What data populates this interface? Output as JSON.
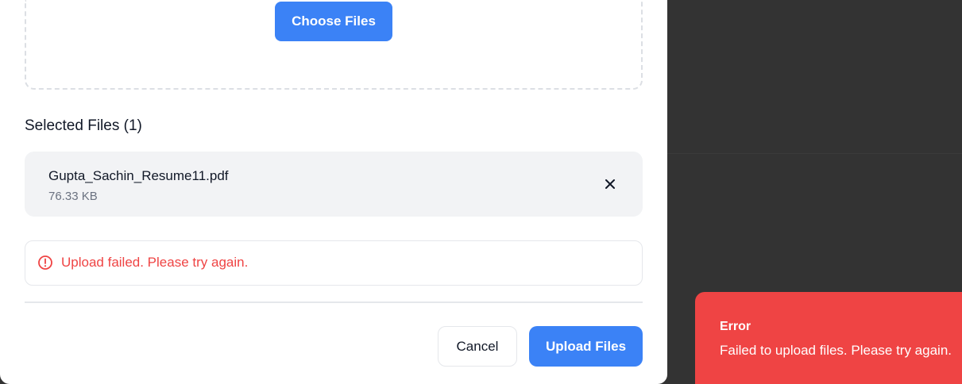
{
  "upload_dialog": {
    "choose_files_label": "Choose Files",
    "selected_files_title": "Selected Files (1)",
    "files": [
      {
        "name": "Gupta_Sachin_Resume11.pdf",
        "size": "76.33 KB"
      }
    ],
    "error_message": "Upload failed. Please try again.",
    "cancel_label": "Cancel",
    "upload_label": "Upload Files"
  },
  "toast": {
    "title": "Error",
    "message": "Failed to upload files. Please try again."
  },
  "colors": {
    "accent": "#3b82f6",
    "error": "#ef4444",
    "backdrop": "#333333"
  },
  "icons": {
    "remove": "close-icon",
    "error": "alert-circle-icon"
  }
}
